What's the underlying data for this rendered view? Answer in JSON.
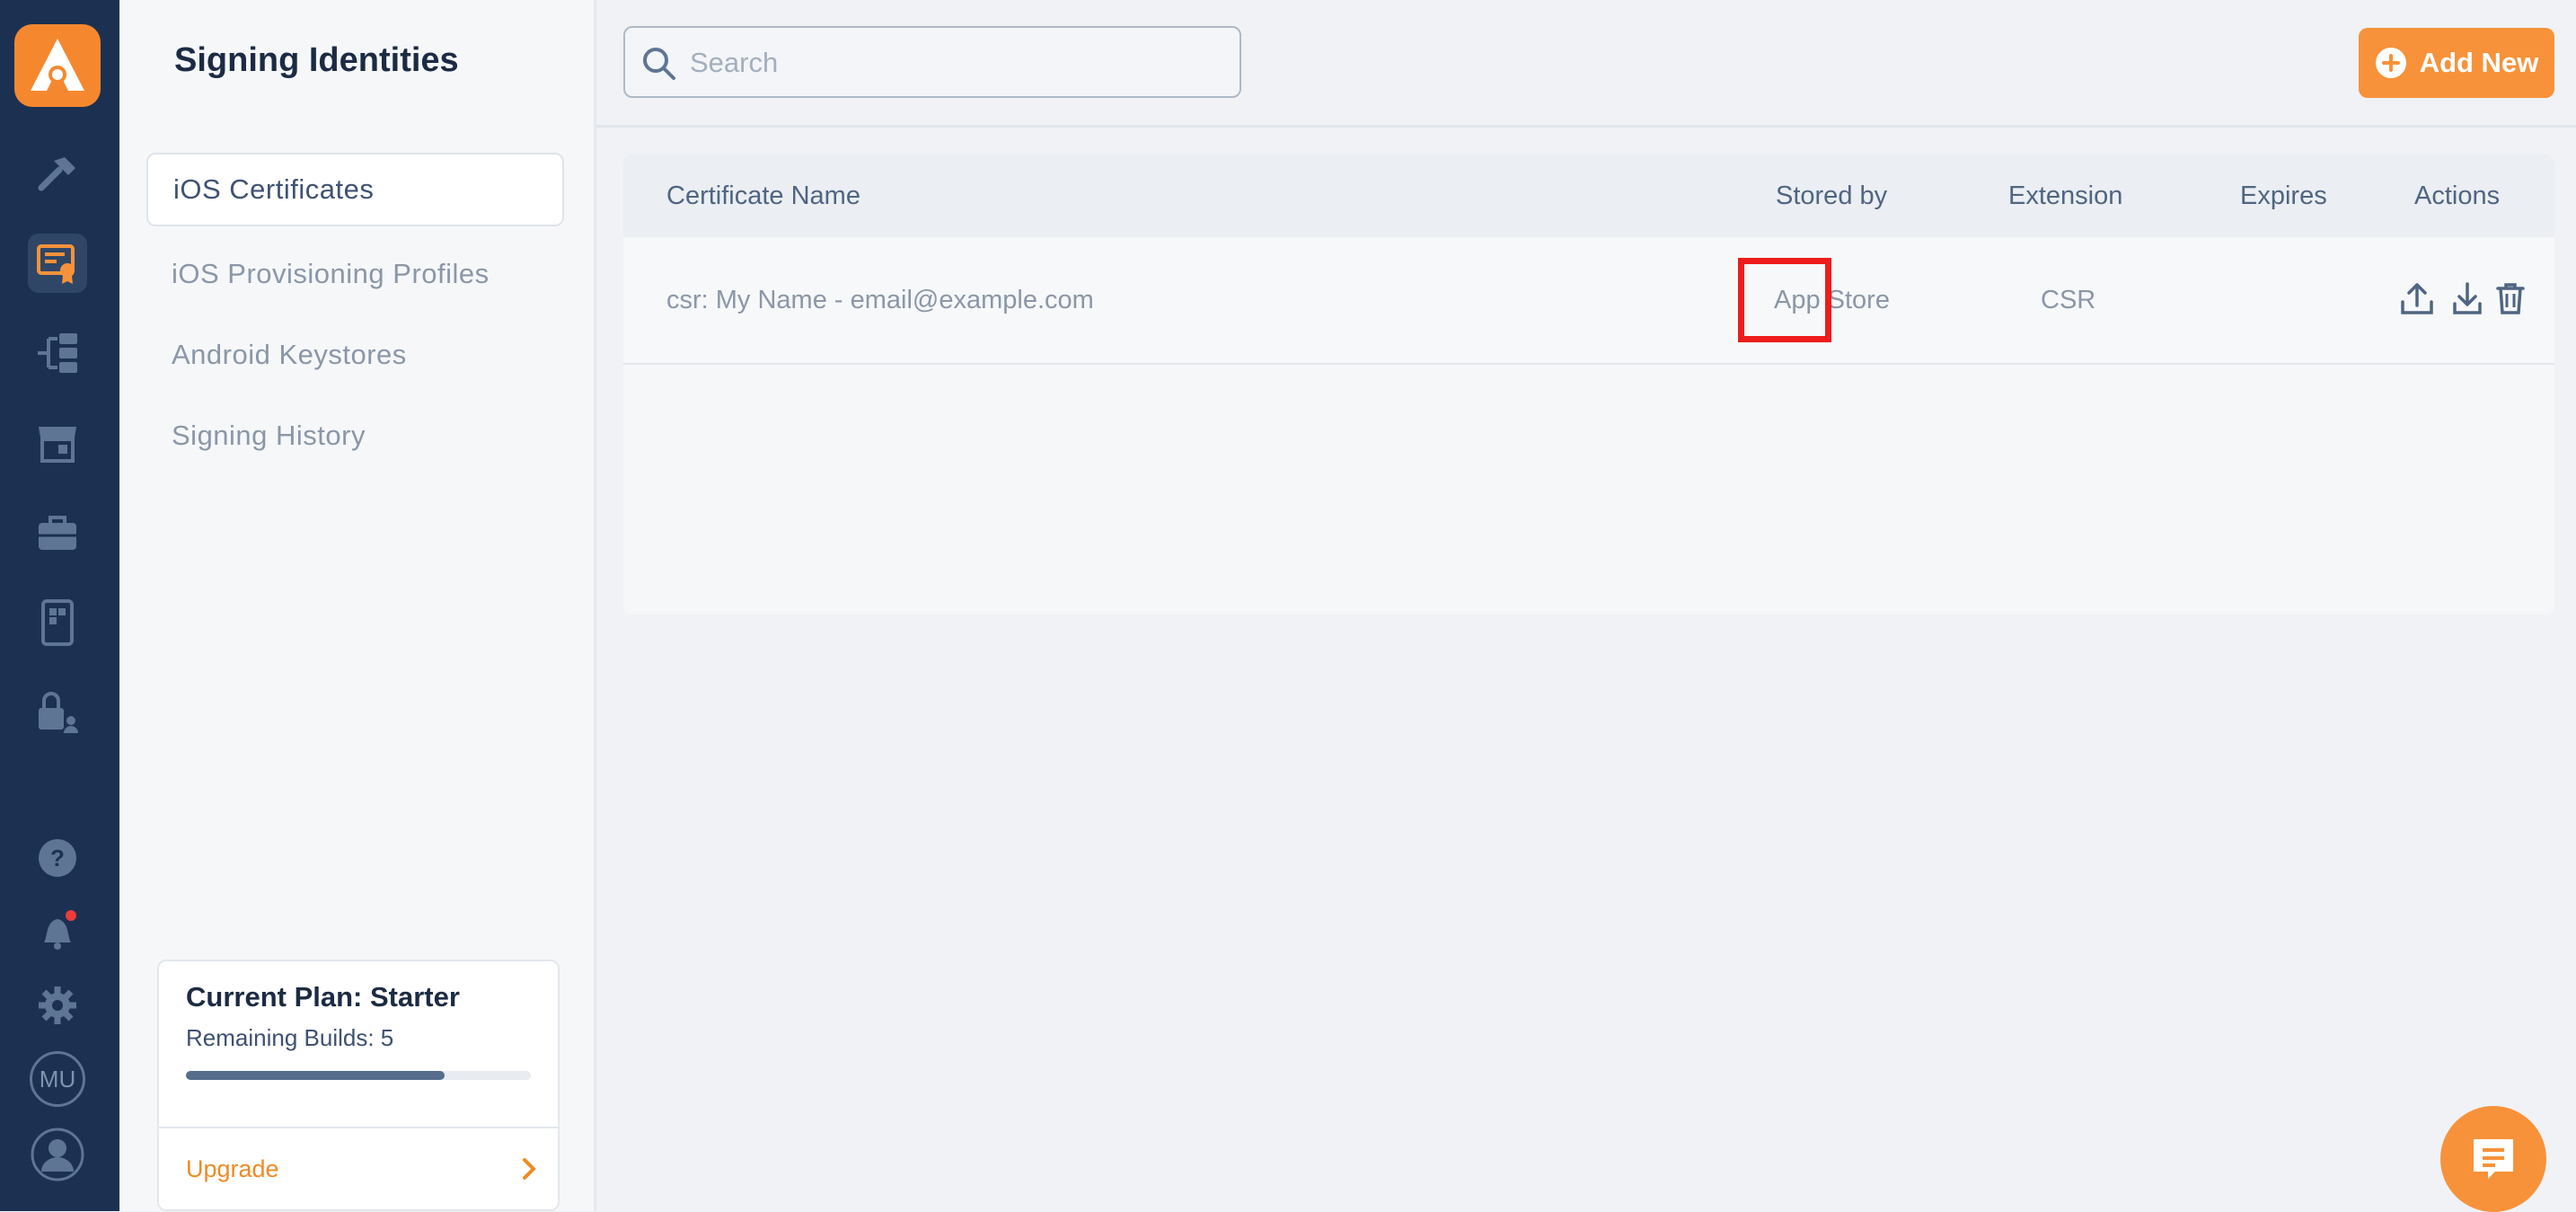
{
  "app": {
    "logo_icon": "appflow-logo-icon",
    "accent_color": "#f7923a",
    "rail_color": "#1c3152"
  },
  "rail": {
    "items": [
      {
        "name": "build-hammer-icon"
      },
      {
        "name": "signing-certificate-icon",
        "active": true
      },
      {
        "name": "workflow-icon"
      },
      {
        "name": "store-icon"
      },
      {
        "name": "briefcase-icon"
      },
      {
        "name": "device-icon"
      },
      {
        "name": "lock-user-icon"
      }
    ],
    "bottom": [
      {
        "name": "help-icon"
      },
      {
        "name": "notifications-bell-icon"
      },
      {
        "name": "settings-gear-icon"
      },
      {
        "name": "user-initials-avatar",
        "label": "MU"
      },
      {
        "name": "profile-avatar-icon"
      }
    ]
  },
  "sidebar": {
    "title": "Signing Identities",
    "items": [
      {
        "label": "iOS Certificates",
        "active": true
      },
      {
        "label": "iOS Provisioning Profiles"
      },
      {
        "label": "Android Keystores"
      },
      {
        "label": "Signing History"
      }
    ],
    "plan": {
      "title": "Current Plan: Starter",
      "remaining": "Remaining Builds: 5",
      "progress_fraction": 0.75,
      "upgrade_label": "Upgrade"
    }
  },
  "toolbar": {
    "search_placeholder": "Search",
    "add_label": "Add New"
  },
  "table": {
    "columns": [
      "Certificate Name",
      "Stored by",
      "Extension",
      "Expires",
      "Actions"
    ],
    "rows": [
      {
        "name": "csr: My Name - email@example.com",
        "stored_by": "App Store",
        "extension": "CSR",
        "expires": "",
        "actions": [
          "upload-icon",
          "download-icon",
          "trash-icon"
        ]
      }
    ]
  },
  "chat": {
    "icon": "chat-support-icon"
  }
}
